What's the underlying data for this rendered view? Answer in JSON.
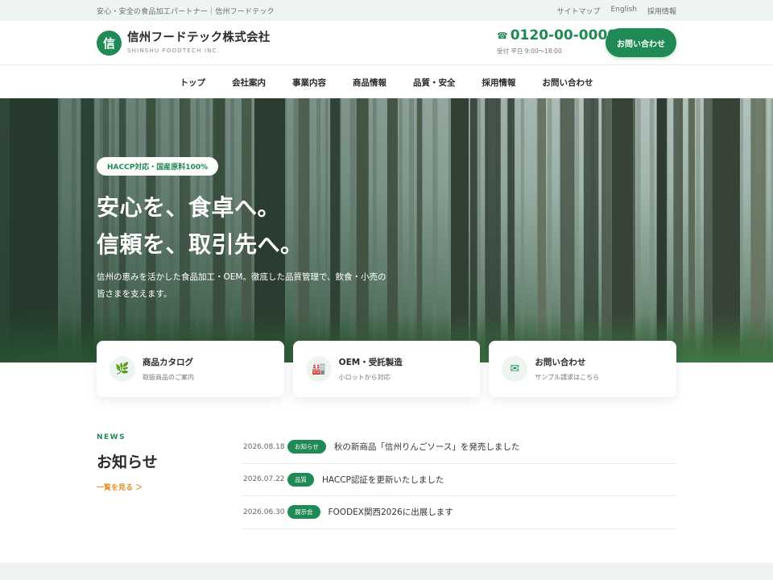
{
  "topbar": {
    "tagline": "安心・安全の食品加工パートナー｜信州フードテック",
    "links": [
      "サイトマップ",
      "English",
      "採用情報"
    ]
  },
  "header": {
    "logo_char": "信",
    "company_name": "信州フードテック株式会社",
    "company_en": "SHINSHU FOODTECH INC.",
    "phone_icon": "☎",
    "phone": "0120-00-0000",
    "hours": "受付 平日 9:00〜18:00",
    "cta": "お問い合わせ"
  },
  "nav": {
    "items": [
      "トップ",
      "会社案内",
      "事業内容",
      "商品情報",
      "品質・安全",
      "採用情報",
      "お問い合わせ"
    ]
  },
  "hero": {
    "badge": "HACCP対応・国産原料100%",
    "headline_1": "安心を、食卓へ。",
    "headline_2": "信頼を、取引先へ。",
    "lead": "信州の恵みを活かした食品加工・OEM。徹底した品質管理で、飲食・小売の皆さまを支えます。"
  },
  "cards": [
    {
      "icon": "leaf-icon",
      "glyph": "🌿",
      "title": "商品カタログ",
      "sub": "取扱商品のご案内"
    },
    {
      "icon": "factory-icon",
      "glyph": "🏭",
      "title": "OEM・受託製造",
      "sub": "小ロットから対応"
    },
    {
      "icon": "mail-icon",
      "glyph": "✉",
      "title": "お問い合わせ",
      "sub": "サンプル請求はこちら"
    }
  ],
  "news": {
    "label": "NEWS",
    "heading": "お知らせ",
    "more": "一覧を見る ＞",
    "items": [
      {
        "date": "2026.08.18",
        "tag": "お知らせ",
        "title": "秋の新商品「信州りんごソース」を発売しました"
      },
      {
        "date": "2026.07.22",
        "tag": "品質",
        "title": "HACCP認証を更新いたしました"
      },
      {
        "date": "2026.06.30",
        "tag": "展示会",
        "title": "FOODEX関西2026に出展します"
      }
    ]
  },
  "colors": {
    "accent": "#1f8a55",
    "accent_light": "#eef5f0",
    "link_orange": "#e0902a"
  }
}
